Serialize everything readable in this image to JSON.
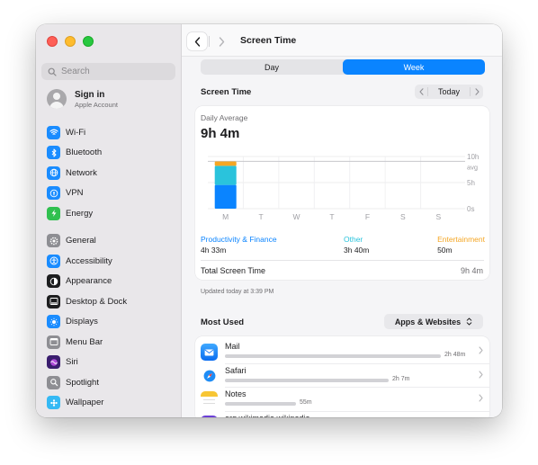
{
  "window": {
    "title": "Screen Time"
  },
  "sidebar": {
    "search_placeholder": "Search",
    "account": {
      "title": "Sign in",
      "subtitle": "Apple Account"
    },
    "groups": [
      [
        {
          "label": "Wi-Fi",
          "icon": "wifi-icon",
          "color": "#1a8cff"
        },
        {
          "label": "Bluetooth",
          "icon": "bluetooth-icon",
          "color": "#1a8cff"
        },
        {
          "label": "Network",
          "icon": "globe-icon",
          "color": "#1a8cff"
        },
        {
          "label": "VPN",
          "icon": "vpn-icon",
          "color": "#1a8cff"
        },
        {
          "label": "Energy",
          "icon": "energy-icon",
          "color": "#30c04f"
        }
      ],
      [
        {
          "label": "General",
          "icon": "gear-icon",
          "color": "#8e8e93"
        },
        {
          "label": "Accessibility",
          "icon": "accessibility-icon",
          "color": "#1a8cff"
        },
        {
          "label": "Appearance",
          "icon": "appearance-icon",
          "color": "#1d1d1f"
        },
        {
          "label": "Desktop & Dock",
          "icon": "dock-icon",
          "color": "#1d1d1f"
        },
        {
          "label": "Displays",
          "icon": "displays-icon",
          "color": "#1a8cff"
        },
        {
          "label": "Menu Bar",
          "icon": "menubar-icon",
          "color": "#8e8e93"
        },
        {
          "label": "Siri",
          "icon": "siri-icon",
          "color": "#3a1d6e"
        },
        {
          "label": "Spotlight",
          "icon": "spotlight-icon",
          "color": "#8e8e93"
        },
        {
          "label": "Wallpaper",
          "icon": "wallpaper-icon",
          "color": "#35b9f4"
        }
      ]
    ]
  },
  "segment": {
    "options": [
      "Day",
      "Week"
    ],
    "selected": "Week"
  },
  "screen_time": {
    "section_title": "Screen Time",
    "period_label": "Today",
    "daily_average_label": "Daily Average",
    "daily_average_value": "9h 4m",
    "categories": [
      {
        "name": "Productivity & Finance",
        "time": "4h 33m",
        "color": "#0a84ff"
      },
      {
        "name": "Other",
        "time": "3h 40m",
        "color": "#2ac3dc"
      },
      {
        "name": "Entertainment",
        "time": "50m",
        "color": "#f5a623"
      }
    ],
    "total_label": "Total Screen Time",
    "total_value": "9h 4m",
    "updated": "Updated today at 3:39 PM"
  },
  "chart_data": {
    "type": "bar",
    "stacked": true,
    "categories": [
      "M",
      "T",
      "W",
      "T",
      "F",
      "S",
      "S"
    ],
    "series": [
      {
        "name": "Productivity & Finance",
        "values": [
          4.55,
          0,
          0,
          0,
          0,
          0,
          0
        ],
        "color": "#0a84ff"
      },
      {
        "name": "Other",
        "values": [
          3.67,
          0,
          0,
          0,
          0,
          0,
          0
        ],
        "color": "#2ac3dc"
      },
      {
        "name": "Entertainment",
        "values": [
          0.83,
          0,
          0,
          0,
          0,
          0,
          0
        ],
        "color": "#f5a623"
      }
    ],
    "y_ticks": [
      "10h",
      "5h",
      "0s"
    ],
    "average_label": "avg",
    "average_value": 9.07,
    "ylim": [
      0,
      10
    ]
  },
  "most_used": {
    "title": "Most Used",
    "filter_label": "Apps & Websites",
    "apps": [
      {
        "name": "Mail",
        "time": "2h 48m",
        "icon": "mail-icon",
        "fraction": 1.0
      },
      {
        "name": "Safari",
        "time": "2h 7m",
        "icon": "safari-icon",
        "fraction": 0.76
      },
      {
        "name": "Notes",
        "time": "55m",
        "icon": "notes-icon",
        "fraction": 0.33
      },
      {
        "name": "org.wikimedia.wikipedia",
        "time": "",
        "icon": "wikipedia-icon",
        "fraction": 0.2
      }
    ]
  }
}
